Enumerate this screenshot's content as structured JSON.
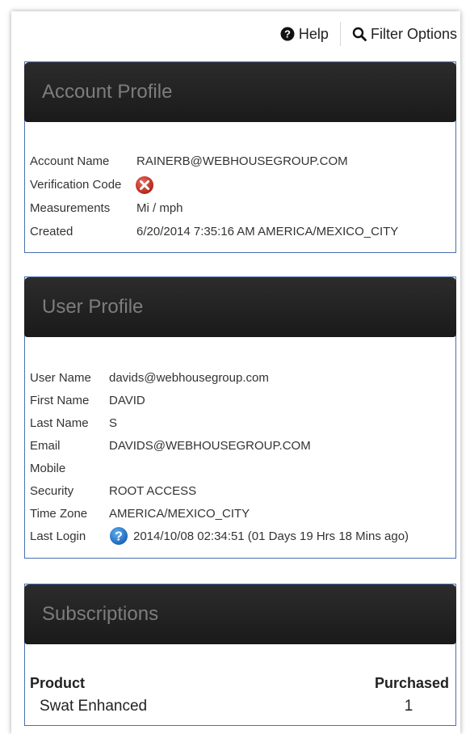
{
  "toolbar": {
    "help_label": "Help",
    "help_icon": "question-circle-icon",
    "filter_label": "Filter Options",
    "filter_icon": "search-icon"
  },
  "account": {
    "title": "Account Profile",
    "fields": [
      {
        "label": "Account Name",
        "value": "RAINERB@WEBHOUSEGROUP.COM"
      },
      {
        "label": "Verification Code",
        "value": "",
        "icon": "error-x-icon"
      },
      {
        "label": "Measurements",
        "value": "Mi / mph"
      },
      {
        "label": "Created",
        "value": "6/20/2014 7:35:16 AM AMERICA/MEXICO_CITY"
      }
    ]
  },
  "user": {
    "title": "User Profile",
    "fields": [
      {
        "label": "User Name",
        "value": "davids@webhousegroup.com"
      },
      {
        "label": "First Name",
        "value": "DAVID"
      },
      {
        "label": "Last Name",
        "value": "S"
      },
      {
        "label": "Email",
        "value": "DAVIDS@WEBHOUSEGROUP.COM"
      },
      {
        "label": "Mobile",
        "value": ""
      },
      {
        "label": "Security",
        "value": "ROOT ACCESS"
      },
      {
        "label": "Time Zone",
        "value": "AMERICA/MEXICO_CITY"
      },
      {
        "label": "Last Login",
        "value": "2014/10/08 02:34:51 (01 Days 19 Hrs 18 Mins ago)",
        "icon": "help-info-icon"
      }
    ]
  },
  "subscriptions": {
    "title": "Subscriptions",
    "headers": {
      "product": "Product",
      "purchased": "Purchased"
    },
    "rows": [
      {
        "product": "Swat Enhanced",
        "purchased": "1"
      }
    ]
  },
  "colors": {
    "panel_header_bg": "#222222",
    "panel_border": "#4a6fb0",
    "error_red": "#c9302c",
    "info_blue": "#2a7fd4"
  }
}
